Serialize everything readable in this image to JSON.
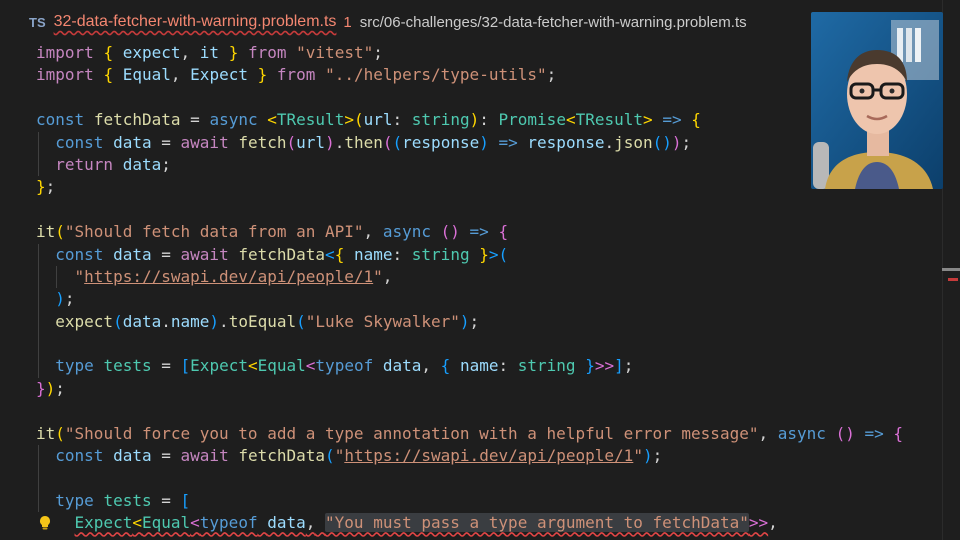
{
  "tab": {
    "lang_badge": "TS",
    "file_name": "32-data-fetcher-with-warning.problem.ts",
    "problem_count": "1",
    "path": "src/06-challenges/32-data-fetcher-with-warning.problem.ts"
  },
  "code": {
    "l1": {
      "a": "import",
      "b": "{",
      "c": "expect",
      "d": ",",
      "e": "it",
      "f": "}",
      "g": "from",
      "h": "\"vitest\"",
      "i": ";"
    },
    "l2": {
      "a": "import",
      "b": "{",
      "c": "Equal",
      "d": ",",
      "e": "Expect",
      "f": "}",
      "g": "from",
      "h": "\"../helpers/type-utils\"",
      "i": ";"
    },
    "l4": {
      "a": "const",
      "b": "fetchData",
      "c": "=",
      "d": "async",
      "e": "<",
      "f": "TResult",
      "g": ">",
      "h": "(",
      "i": "url",
      "j": ":",
      "k": "string",
      "l": ")",
      "m": ":",
      "n": "Promise",
      "o": "<",
      "p": "TResult",
      "q": ">",
      "r": "=>",
      "s": "{"
    },
    "l5": {
      "a": "const",
      "b": "data",
      "c": "=",
      "d": "await",
      "e": "fetch",
      "f": "(",
      "g": "url",
      "h": ")",
      "i": ".",
      "j": "then",
      "k": "(",
      "l": "(",
      "m": "response",
      "n": ")",
      "o": "=>",
      "p": "response",
      "q": ".",
      "r": "json",
      "s": "()",
      "t": ")",
      "u": ";"
    },
    "l6": {
      "a": "return",
      "b": "data",
      "c": ";"
    },
    "l7": {
      "a": "}",
      "b": ";"
    },
    "l9": {
      "a": "it",
      "b": "(",
      "c": "\"Should fetch data from an API\"",
      "d": ",",
      "e": "async",
      "f": "()",
      "g": "=>",
      "h": "{"
    },
    "l10": {
      "a": "const",
      "b": "data",
      "c": "=",
      "d": "await",
      "e": "fetchData",
      "f": "<",
      "g": "{",
      "h": "name",
      "i": ":",
      "j": "string",
      "k": "}",
      "l": ">",
      "m": "("
    },
    "l11": {
      "q1": "\"",
      "url": "https://swapi.dev/api/people/1",
      "q2": "\"",
      "c": ","
    },
    "l12": {
      "a": ")",
      "b": ";"
    },
    "l13": {
      "a": "expect",
      "b": "(",
      "c": "data",
      "d": ".",
      "e": "name",
      "f": ")",
      "g": ".",
      "h": "toEqual",
      "i": "(",
      "j": "\"Luke Skywalker\"",
      "k": ")",
      "l": ";"
    },
    "l15": {
      "a": "type",
      "b": "tests",
      "c": "=",
      "d": "[",
      "e": "Expect",
      "f": "<",
      "g": "Equal",
      "h": "<",
      "i": "typeof",
      "j": "data",
      "k": ",",
      "l": "{",
      "m": "name",
      "n": ":",
      "o": "string",
      "p": "}",
      "q": ">>",
      "r": "]",
      "s": ";"
    },
    "l16": {
      "a": "}",
      "b": ")",
      "c": ";"
    },
    "l18": {
      "a": "it",
      "b": "(",
      "c": "\"Should force you to add a type annotation with a helpful error message\"",
      "d": ",",
      "e": "async",
      "f": "()",
      "g": "=>",
      "h": "{"
    },
    "l19": {
      "a": "const",
      "b": "data",
      "c": "=",
      "d": "await",
      "e": "fetchData",
      "f": "(",
      "q1": "\"",
      "url": "https://swapi.dev/api/people/1",
      "q2": "\"",
      "g": ")",
      "h": ";"
    },
    "l21": {
      "a": "type",
      "b": "tests",
      "c": "=",
      "d": "["
    },
    "l22": {
      "a": "Expect",
      "b": "<",
      "c": "Equal",
      "d": "<",
      "e": "typeof",
      "f": "data",
      "g": ",",
      "h": "\"You must pass a type argument to fetchData\"",
      "i": ">>",
      "j": ","
    }
  },
  "colors": {
    "error": "#f48771",
    "keyword": "#c586c0",
    "storage": "#569cd6",
    "function": "#dcdcaa",
    "variable": "#9cdcfe",
    "type": "#4ec9b0",
    "string": "#ce9178"
  },
  "icons": {
    "lightbulb": "lightbulb-icon",
    "webcam": "presenter-webcam"
  }
}
